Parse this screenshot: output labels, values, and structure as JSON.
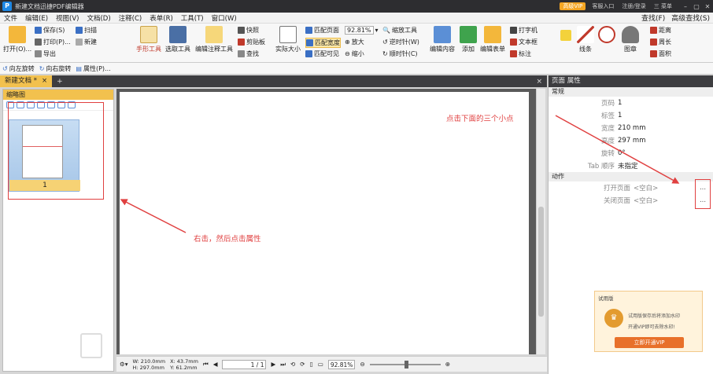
{
  "titlebar": {
    "title": "新建文档迅捷PDF编辑器",
    "vip": "高级VIP",
    "items": [
      "客服入口",
      "注册/登录",
      "三 菜单"
    ]
  },
  "menubar": {
    "items": [
      "文件",
      "编辑(E)",
      "视图(V)",
      "文档(D)",
      "注释(C)",
      "表单(R)",
      "工具(T)",
      "窗口(W)"
    ],
    "right": [
      "查找(F)",
      "高级查找(S)"
    ]
  },
  "toolbar": {
    "open": "打开(O)...",
    "save": "保存(S)",
    "print": "打印(P)...",
    "export": "导出",
    "scan": "扫描",
    "new": "新建",
    "hand_tool": "手形工具",
    "select_tool": "选取工具",
    "edit_annot": "编辑注释工具",
    "snapshot": "快照",
    "clipboard": "剪贴板",
    "find": "查找",
    "actual_size": "实际大小",
    "fit_page": "匹配页面",
    "fit_width": "匹配宽度",
    "fit_visible": "匹配可见",
    "zoom_value": "92.81%",
    "zoom_tool": "缩放工具",
    "zoom_in": "放大",
    "zoom_out": "缩小",
    "rotate_ccw": "逆时针(W)",
    "rotate_cw": "顺时针(C)",
    "edit_content": "编辑内容",
    "add": "添加",
    "edit_form": "编辑表单",
    "typewriter": "打字机",
    "textbox": "文本框",
    "annotation": "标注",
    "line": "线条",
    "stamp": "图章",
    "distance": "距离",
    "perimeter": "周长",
    "area": "面积"
  },
  "toolbar2": {
    "rotate_left": "向左旋转",
    "rotate_right": "向右旋转",
    "properties": "属性(P)..."
  },
  "tab": {
    "label": "新建文档 *"
  },
  "thumbs": {
    "header": "缩略图",
    "page_label": "1"
  },
  "statusbar": {
    "size": "W: 210.0mm\nH: 297.0mm",
    "coords": "X: 43.7mm\nY: 61.2mm",
    "page": "1 / 1",
    "zoom": "92.81%"
  },
  "props": {
    "header": "页面 属性",
    "section_general": "常规",
    "section_actions": "动作",
    "rows": [
      {
        "k": "页码",
        "v": "1"
      },
      {
        "k": "标签",
        "v": "1"
      },
      {
        "k": "宽度",
        "v": "210 mm"
      },
      {
        "k": "高度",
        "v": "297 mm"
      },
      {
        "k": "旋转",
        "v": "0°"
      },
      {
        "k": "Tab 顺序",
        "v": "未指定"
      }
    ],
    "actions": [
      {
        "k": "打开页面",
        "v": "<空白>"
      },
      {
        "k": "关闭页面",
        "v": "<空白>"
      }
    ],
    "dots": "..."
  },
  "promo": {
    "title": "试用版",
    "line1": "试用版保存后将添加水印",
    "line2": "开通VIP即可去除水印!",
    "button": "立即开通VIP"
  },
  "annotations": {
    "top": "点击下面的三个小点",
    "bottom": "右击，然后点击属性"
  },
  "colors": {
    "accent": "#f2c14e",
    "annotation": "#e04040",
    "vip": "#f5a623"
  }
}
